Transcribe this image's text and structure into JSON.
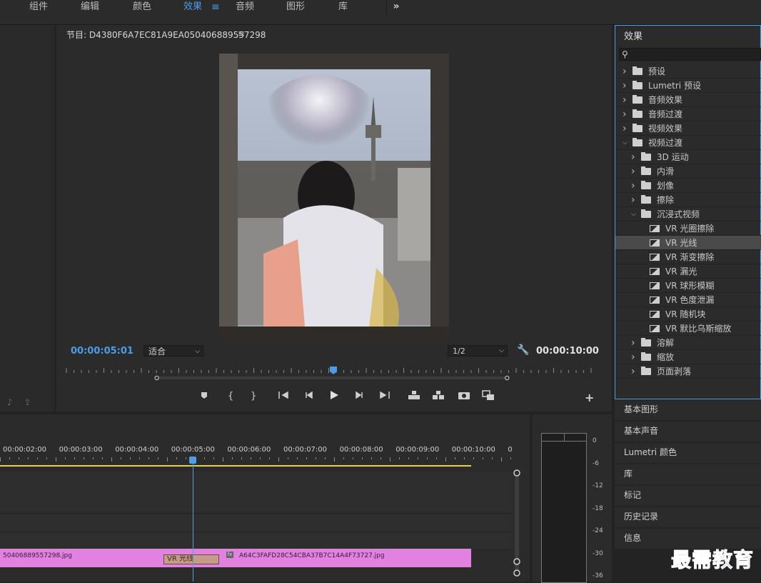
{
  "workspaces": {
    "items": [
      {
        "label": "组件",
        "active": false
      },
      {
        "label": "编辑",
        "active": false
      },
      {
        "label": "颜色",
        "active": false
      },
      {
        "label": "效果",
        "active": true
      },
      {
        "label": "音频",
        "active": false
      },
      {
        "label": "图形",
        "active": false
      },
      {
        "label": "库",
        "active": false
      }
    ],
    "menu_glyph": "≡",
    "more_glyph": "»"
  },
  "program": {
    "title": "节目: D4380F6A7EC81A9EA050406889557298",
    "menu_glyph": "≡",
    "timecode_current": "00:00:05:01",
    "fit_value": "适合",
    "resolution_value": "1/2",
    "timecode_duration": "00:00:10:00",
    "add_glyph": "+",
    "transport_icons": [
      "marker-icon",
      "mark-in-icon",
      "mark-out-icon",
      "go-to-in-icon",
      "step-back-icon",
      "play-icon",
      "step-forward-icon",
      "go-to-out-icon",
      "lift-icon",
      "extract-icon",
      "export-frame-icon",
      "comparison-view-icon"
    ]
  },
  "effects_panel": {
    "title": "效果",
    "tree": [
      {
        "label": "预设",
        "level": 0,
        "icon": "preset-folder-icon",
        "expanded": false
      },
      {
        "label": "Lumetri 预设",
        "level": 0,
        "icon": "preset-folder-icon",
        "expanded": false
      },
      {
        "label": "音频效果",
        "level": 0,
        "icon": "folder-icon",
        "expanded": false
      },
      {
        "label": "音频过渡",
        "level": 0,
        "icon": "folder-icon",
        "expanded": false
      },
      {
        "label": "视频效果",
        "level": 0,
        "icon": "folder-icon",
        "expanded": false
      },
      {
        "label": "视频过渡",
        "level": 0,
        "icon": "folder-icon",
        "expanded": true
      },
      {
        "label": "3D 运动",
        "level": 1,
        "icon": "folder-icon",
        "expanded": false
      },
      {
        "label": "内滑",
        "level": 1,
        "icon": "folder-icon",
        "expanded": false
      },
      {
        "label": "划像",
        "level": 1,
        "icon": "folder-icon",
        "expanded": false
      },
      {
        "label": "擦除",
        "level": 1,
        "icon": "folder-icon",
        "expanded": false
      },
      {
        "label": "沉浸式视频",
        "level": 1,
        "icon": "folder-icon",
        "expanded": true
      },
      {
        "label": "VR 光圈擦除",
        "level": 2,
        "icon": "transition-icon"
      },
      {
        "label": "VR 光线",
        "level": 2,
        "icon": "transition-icon",
        "selected": true
      },
      {
        "label": "VR 渐变擦除",
        "level": 2,
        "icon": "transition-icon"
      },
      {
        "label": "VR 漏光",
        "level": 2,
        "icon": "transition-icon"
      },
      {
        "label": "VR 球形模糊",
        "level": 2,
        "icon": "transition-icon"
      },
      {
        "label": "VR 色度泄漏",
        "level": 2,
        "icon": "transition-icon"
      },
      {
        "label": "VR 随机块",
        "level": 2,
        "icon": "transition-icon"
      },
      {
        "label": "VR 默比乌斯缩放",
        "level": 2,
        "icon": "transition-icon"
      },
      {
        "label": "溶解",
        "level": 1,
        "icon": "folder-icon",
        "expanded": false
      },
      {
        "label": "缩放",
        "level": 1,
        "icon": "folder-icon",
        "expanded": false
      },
      {
        "label": "页面剥落",
        "level": 1,
        "icon": "folder-icon",
        "expanded": false
      }
    ]
  },
  "stacked_panels": [
    "基本图形",
    "基本声音",
    "Lumetri 颜色",
    "库",
    "标记",
    "历史记录",
    "信息"
  ],
  "timeline": {
    "ruler_labels": [
      "00:00:02:00",
      "00:00:03:00",
      "00:00:04:00",
      "00:00:05:00",
      "00:00:06:00",
      "00:00:07:00",
      "00:00:08:00",
      "00:00:09:00",
      "00:00:10:00",
      "0"
    ],
    "clip_a_name": "50406889557298.jpg",
    "clip_b_name": "A64C3FAFD28C54CBA37B7C14A4F73727.jpg",
    "fx_badge": "fx",
    "transition_label": "VR 光线"
  },
  "audio_meter": {
    "db_labels": [
      "0",
      "-6",
      "-12",
      "-18",
      "-24",
      "-30",
      "-36"
    ]
  },
  "watermark": "最需教育",
  "colors": {
    "accent": "#4a9ee8",
    "clip": "#e282e0",
    "transition": "#c69b87",
    "work_area": "#e7d13a"
  }
}
